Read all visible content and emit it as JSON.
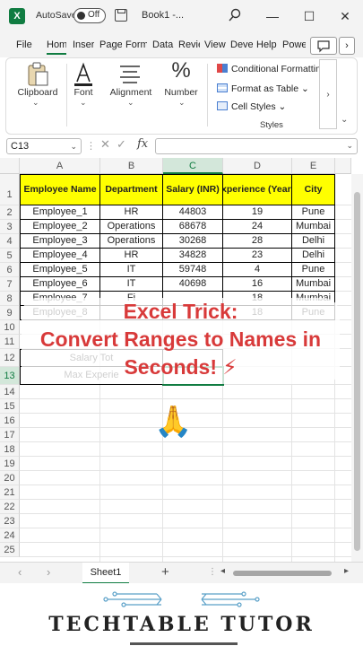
{
  "titlebar": {
    "app_icon": "X",
    "autosave_label": "AutoSave",
    "autosave_state": "Off",
    "book_title": "Book1  -...",
    "buttons": [
      "search-icon",
      "minimize-icon",
      "maximize-icon",
      "close-icon"
    ]
  },
  "menu": {
    "items": [
      "File",
      "Home",
      "Insert",
      "Page Layout",
      "Formulas",
      "Data",
      "Review",
      "View",
      "Developer",
      "Help",
      "Power Pivot"
    ],
    "more": "›"
  },
  "ribbon": {
    "clipboard_label": "Clipboard",
    "font_label": "Font",
    "alignment_label": "Alignment",
    "number_label": "Number",
    "number_glyph": "%",
    "conditional_formatting": "Conditional Formatting",
    "format_as_table": "Format as Table",
    "cell_styles": "Cell Styles",
    "styles_label": "Styles",
    "chevron": "⌄",
    "scroll": "›"
  },
  "formula_bar": {
    "name_box": "C13",
    "fx": "fx",
    "value": ""
  },
  "sheet": {
    "columns": [
      "A",
      "B",
      "C",
      "D",
      "E"
    ],
    "selected_column": "C",
    "selected_row": "13",
    "rows": [
      "1",
      "2",
      "3",
      "4",
      "5",
      "6",
      "7",
      "8",
      "9",
      "10",
      "11",
      "12",
      "13",
      "14",
      "15",
      "16",
      "17",
      "18",
      "19",
      "20",
      "21",
      "22",
      "23",
      "24",
      "25"
    ],
    "headers": [
      "Employee Name",
      "Department",
      "Salary (INR)",
      "Experience (Years)",
      "City"
    ],
    "data": [
      [
        "Employee_1",
        "HR",
        "44803",
        "19",
        "Pune"
      ],
      [
        "Employee_2",
        "Operations",
        "68678",
        "24",
        "Mumbai"
      ],
      [
        "Employee_3",
        "Operations",
        "30268",
        "28",
        "Delhi"
      ],
      [
        "Employee_4",
        "HR",
        "34828",
        "23",
        "Delhi"
      ],
      [
        "Employee_5",
        "IT",
        "59748",
        "4",
        "Pune"
      ],
      [
        "Employee_6",
        "IT",
        "40698",
        "16",
        "Mumbai"
      ],
      [
        "Employee_7",
        "Fi",
        "",
        "18",
        "Mumbai"
      ],
      [
        "Employee_8",
        "",
        "",
        "18",
        "Pune"
      ]
    ],
    "summary": [
      "Salary Tot",
      "Max Experie"
    ]
  },
  "overlay": {
    "line1": "Excel Trick:",
    "line2": "Convert Ranges to Names in",
    "line3": "Seconds! ⚡",
    "emoji": "🙏"
  },
  "tabs": {
    "sheet_name": "Sheet1",
    "add": "+",
    "prev": "‹",
    "next": "›"
  },
  "brand": {
    "name": "TECHTABLE TUTOR"
  },
  "colors": {
    "excel_green": "#107c41",
    "header_fill": "#ffff00",
    "overlay_text": "#d83a3a"
  }
}
